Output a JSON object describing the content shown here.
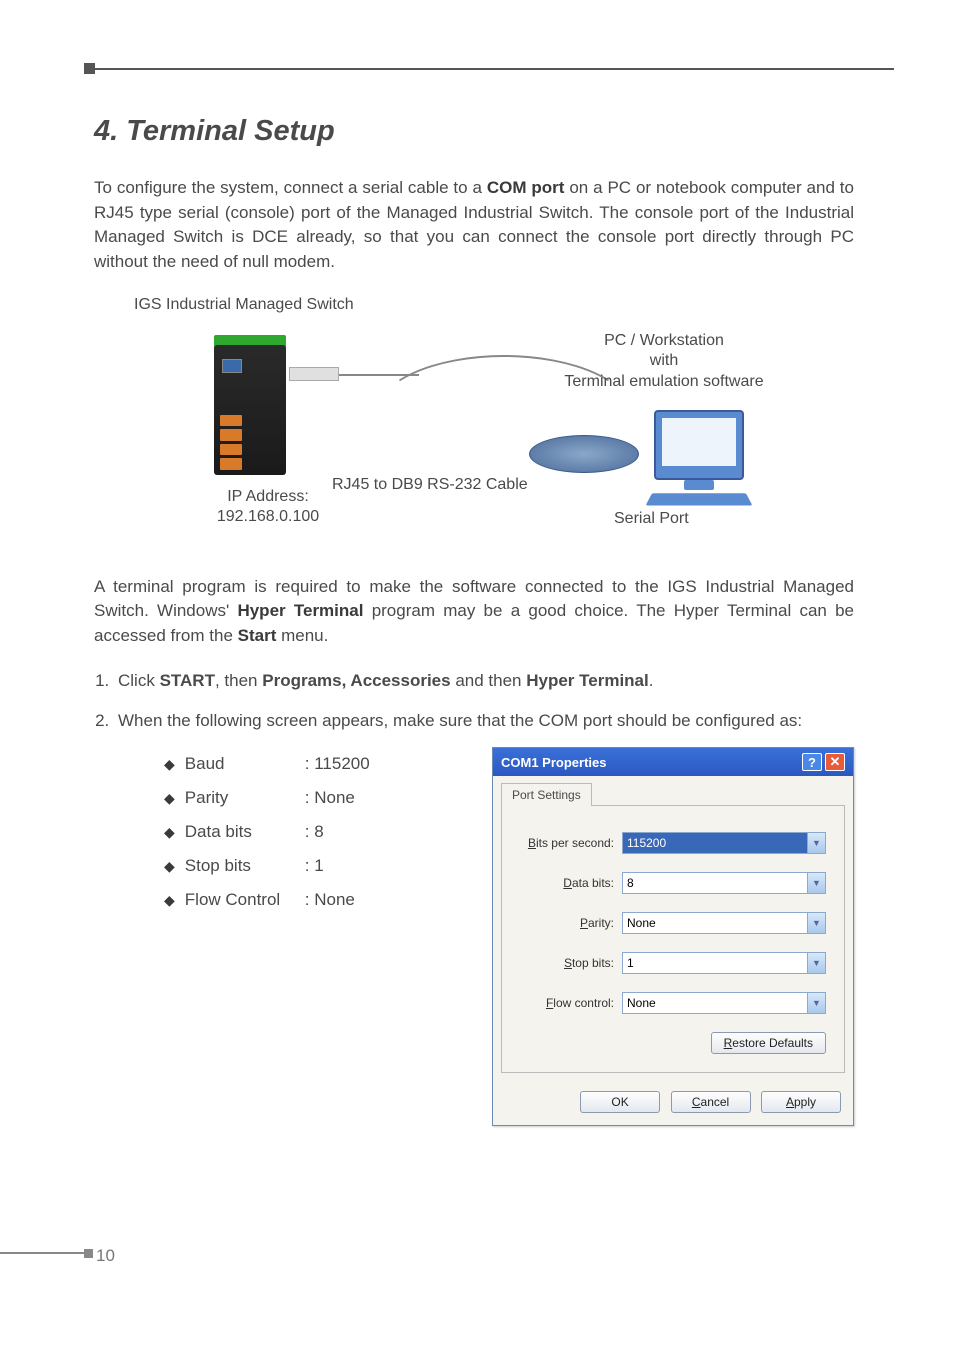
{
  "page_number": "10",
  "heading": "4. Terminal Setup",
  "intro_html": "To configure the system, connect a serial cable to a <b>COM port</b> on a PC or notebook computer and to RJ45 type serial (console) port of the Managed Industrial Switch. The console port of the Industrial Managed Switch is DCE already, so that you can connect the console port directly through PC without the need of null modem.",
  "diagram": {
    "switch_label": "IGS Industrial Managed Switch",
    "ip_label": "IP Address:",
    "ip_value": "192.168.0.100",
    "cable_label": "RJ45 to DB9 RS-232 Cable",
    "pc_label_l1": "PC / Workstation",
    "pc_label_l2": "with",
    "pc_label_l3": "Terminal emulation software",
    "serial_label": "Serial Port"
  },
  "para2_html": "A terminal program is required to make the software connected to the IGS Industrial Managed Switch. Windows' <b>Hyper Terminal</b> program may be a good choice. The Hyper Terminal can be accessed from the <b>Start</b> menu.",
  "steps": {
    "s1_html": "Click <b>START</b>, then <b>Programs, Accessories</b> and then <b>Hyper Terminal</b>.",
    "s2": "When the following screen appears, make sure that the COM port should be configured as:"
  },
  "settings": [
    {
      "key": "Baud",
      "val": "115200"
    },
    {
      "key": "Parity",
      "val": "None"
    },
    {
      "key": "Data bits",
      "val": "8"
    },
    {
      "key": "Stop bits",
      "val": "1"
    },
    {
      "key": "Flow Control",
      "val": "None"
    }
  ],
  "dialog": {
    "title": "COM1 Properties",
    "tab": "Port Settings",
    "fields": {
      "bps": {
        "label": "Bits per second:",
        "value": "115200"
      },
      "databits": {
        "label": "Data bits:",
        "value": "8"
      },
      "parity": {
        "label": "Parity:",
        "value": "None"
      },
      "stopbits": {
        "label": "Stop bits:",
        "value": "1"
      },
      "flow": {
        "label": "Flow control:",
        "value": "None"
      }
    },
    "restore": "Restore Defaults",
    "ok": "OK",
    "cancel": "Cancel",
    "apply": "Apply"
  }
}
